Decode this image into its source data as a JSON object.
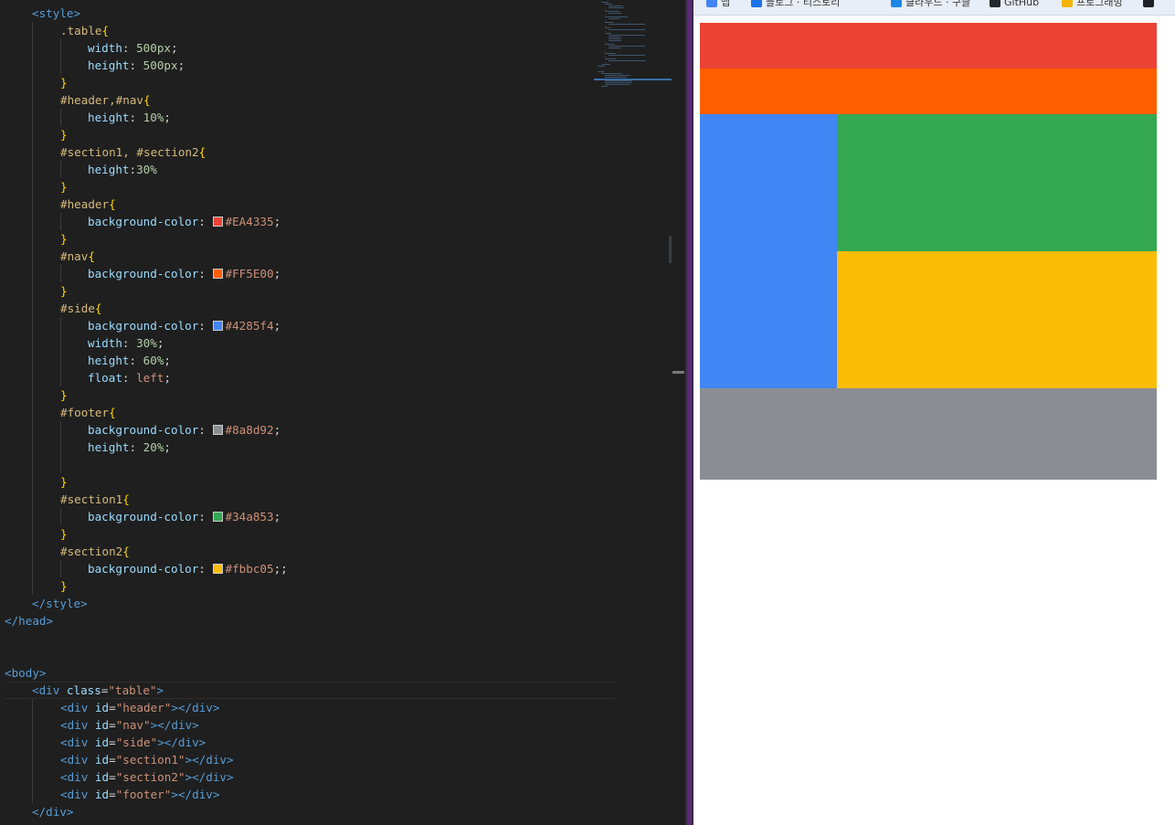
{
  "editor": {
    "lines": [
      [
        [
          "i4",
          ""
        ],
        [
          "tag",
          "<style>"
        ]
      ],
      [
        [
          "i8",
          ""
        ],
        [
          "sel",
          ".table"
        ],
        [
          "brace",
          "{"
        ]
      ],
      [
        [
          "i12",
          ""
        ],
        [
          "prop",
          "width"
        ],
        [
          "plain",
          ": "
        ],
        [
          "num",
          "500px"
        ],
        [
          "plain",
          ";"
        ]
      ],
      [
        [
          "i12",
          ""
        ],
        [
          "prop",
          "height"
        ],
        [
          "plain",
          ": "
        ],
        [
          "num",
          "500px"
        ],
        [
          "plain",
          ";"
        ]
      ],
      [
        [
          "i8",
          ""
        ],
        [
          "brace",
          "}"
        ]
      ],
      [
        [
          "i8",
          ""
        ],
        [
          "sel",
          "#header,#nav"
        ],
        [
          "brace",
          "{"
        ]
      ],
      [
        [
          "i12",
          ""
        ],
        [
          "prop",
          "height"
        ],
        [
          "plain",
          ": "
        ],
        [
          "num",
          "10%"
        ],
        [
          "plain",
          ";"
        ]
      ],
      [
        [
          "i8",
          ""
        ],
        [
          "brace",
          "}"
        ]
      ],
      [
        [
          "i8",
          ""
        ],
        [
          "sel",
          "#section1, #section2"
        ],
        [
          "brace",
          "{"
        ]
      ],
      [
        [
          "i12",
          ""
        ],
        [
          "prop",
          "height"
        ],
        [
          "plain",
          ":"
        ],
        [
          "num",
          "30%"
        ]
      ],
      [
        [
          "i8",
          ""
        ],
        [
          "brace",
          "}"
        ]
      ],
      [
        [
          "i8",
          ""
        ],
        [
          "sel",
          "#header"
        ],
        [
          "brace",
          "{"
        ]
      ],
      [
        [
          "i12",
          ""
        ],
        [
          "prop",
          "background-color"
        ],
        [
          "plain",
          ": "
        ],
        [
          "swatch",
          "#EA4335"
        ],
        [
          "val",
          "#EA4335"
        ],
        [
          "plain",
          ";"
        ]
      ],
      [
        [
          "i8",
          ""
        ],
        [
          "brace",
          "}"
        ]
      ],
      [
        [
          "i8",
          ""
        ],
        [
          "sel",
          "#nav"
        ],
        [
          "brace",
          "{"
        ]
      ],
      [
        [
          "i12",
          ""
        ],
        [
          "prop",
          "background-color"
        ],
        [
          "plain",
          ": "
        ],
        [
          "swatch",
          "#FF5E00"
        ],
        [
          "val",
          "#FF5E00"
        ],
        [
          "plain",
          ";"
        ]
      ],
      [
        [
          "i8",
          ""
        ],
        [
          "brace",
          "}"
        ]
      ],
      [
        [
          "i8",
          ""
        ],
        [
          "sel",
          "#side"
        ],
        [
          "brace",
          "{"
        ]
      ],
      [
        [
          "i12",
          ""
        ],
        [
          "prop",
          "background-color"
        ],
        [
          "plain",
          ": "
        ],
        [
          "swatch",
          "#4285f4"
        ],
        [
          "val",
          "#4285f4"
        ],
        [
          "plain",
          ";"
        ]
      ],
      [
        [
          "i12",
          ""
        ],
        [
          "prop",
          "width"
        ],
        [
          "plain",
          ": "
        ],
        [
          "num",
          "30%"
        ],
        [
          "plain",
          ";"
        ]
      ],
      [
        [
          "i12",
          ""
        ],
        [
          "prop",
          "height"
        ],
        [
          "plain",
          ": "
        ],
        [
          "num",
          "60%"
        ],
        [
          "plain",
          ";"
        ]
      ],
      [
        [
          "i12",
          ""
        ],
        [
          "prop",
          "float"
        ],
        [
          "plain",
          ": "
        ],
        [
          "val",
          "left"
        ],
        [
          "plain",
          ";"
        ]
      ],
      [
        [
          "i8",
          ""
        ],
        [
          "brace",
          "}"
        ]
      ],
      [
        [
          "i8",
          ""
        ],
        [
          "sel",
          "#footer"
        ],
        [
          "brace",
          "{"
        ]
      ],
      [
        [
          "i12",
          ""
        ],
        [
          "prop",
          "background-color"
        ],
        [
          "plain",
          ": "
        ],
        [
          "swatch",
          "#8a8d92"
        ],
        [
          "val",
          "#8a8d92"
        ],
        [
          "plain",
          ";"
        ]
      ],
      [
        [
          "i12",
          ""
        ],
        [
          "prop",
          "height"
        ],
        [
          "plain",
          ": "
        ],
        [
          "num",
          "20%"
        ],
        [
          "plain",
          ";"
        ]
      ],
      [],
      [
        [
          "i8",
          ""
        ],
        [
          "brace",
          "}"
        ]
      ],
      [
        [
          "i8",
          ""
        ],
        [
          "sel",
          "#section1"
        ],
        [
          "brace",
          "{"
        ]
      ],
      [
        [
          "i12",
          ""
        ],
        [
          "prop",
          "background-color"
        ],
        [
          "plain",
          ": "
        ],
        [
          "swatch",
          "#34a853"
        ],
        [
          "val",
          "#34a853"
        ],
        [
          "plain",
          ";"
        ]
      ],
      [
        [
          "i8",
          ""
        ],
        [
          "brace",
          "}"
        ]
      ],
      [
        [
          "i8",
          ""
        ],
        [
          "sel",
          "#section2"
        ],
        [
          "brace",
          "{"
        ]
      ],
      [
        [
          "i12",
          ""
        ],
        [
          "prop",
          "background-color"
        ],
        [
          "plain",
          ": "
        ],
        [
          "swatch",
          "#fbbc05"
        ],
        [
          "val",
          "#fbbc05"
        ],
        [
          "plain",
          ";;"
        ]
      ],
      [
        [
          "i8",
          ""
        ],
        [
          "brace",
          "}"
        ]
      ],
      [
        [
          "i4",
          ""
        ],
        [
          "tag",
          "</style>"
        ]
      ],
      [
        [
          "tag",
          "</head>"
        ]
      ],
      [],
      [],
      [
        [
          "tag",
          "<body>"
        ]
      ],
      [
        [
          "i4",
          ""
        ],
        [
          "tag",
          "<div "
        ],
        [
          "attr",
          "class"
        ],
        [
          "plain",
          "="
        ],
        [
          "str",
          "\"table\""
        ],
        [
          "tag",
          ">"
        ]
      ],
      [
        [
          "i8",
          ""
        ],
        [
          "tag",
          "<div "
        ],
        [
          "attr",
          "id"
        ],
        [
          "plain",
          "="
        ],
        [
          "str",
          "\"header\""
        ],
        [
          "tag",
          "></div>"
        ]
      ],
      [
        [
          "i8",
          ""
        ],
        [
          "tag",
          "<div "
        ],
        [
          "attr",
          "id"
        ],
        [
          "plain",
          "="
        ],
        [
          "str",
          "\"nav\""
        ],
        [
          "tag",
          "></div>"
        ]
      ],
      [
        [
          "i8",
          ""
        ],
        [
          "tag",
          "<div "
        ],
        [
          "attr",
          "id"
        ],
        [
          "plain",
          "="
        ],
        [
          "str",
          "\"side\""
        ],
        [
          "tag",
          "></div>"
        ]
      ],
      [
        [
          "i8",
          ""
        ],
        [
          "tag",
          "<div "
        ],
        [
          "attr",
          "id"
        ],
        [
          "plain",
          "="
        ],
        [
          "str",
          "\"section1\""
        ],
        [
          "tag",
          "></div>"
        ]
      ],
      [
        [
          "i8",
          ""
        ],
        [
          "tag",
          "<div "
        ],
        [
          "attr",
          "id"
        ],
        [
          "plain",
          "="
        ],
        [
          "str",
          "\"section2\""
        ],
        [
          "tag",
          "></div>"
        ]
      ],
      [
        [
          "i8",
          ""
        ],
        [
          "tag",
          "<div "
        ],
        [
          "attr",
          "id"
        ],
        [
          "plain",
          "="
        ],
        [
          "str",
          "\"footer\""
        ],
        [
          "tag",
          "></div>"
        ]
      ],
      [
        [
          "i4",
          ""
        ],
        [
          "tag",
          "</div>"
        ]
      ]
    ],
    "active_line": 39
  },
  "browser": {
    "bookmarks": [
      {
        "label": "앱",
        "color": "#4285f4"
      },
      {
        "label": "블로그 · 티스토리",
        "color": "#1a73e8"
      },
      {
        "label": "클라우드 · 구글",
        "color": "#1e88e5"
      },
      {
        "label": "GitHub",
        "color": "#24292e"
      },
      {
        "label": "프로그래밍",
        "color": "#f4b400"
      },
      {
        "label": "",
        "color": "#202124"
      }
    ],
    "page": {
      "header_color": "#EA4335",
      "nav_color": "#FF5E00",
      "side_color": "#4285f4",
      "section1_color": "#34a853",
      "section2_color": "#fbbc05",
      "footer_color": "#8a8d92"
    }
  }
}
